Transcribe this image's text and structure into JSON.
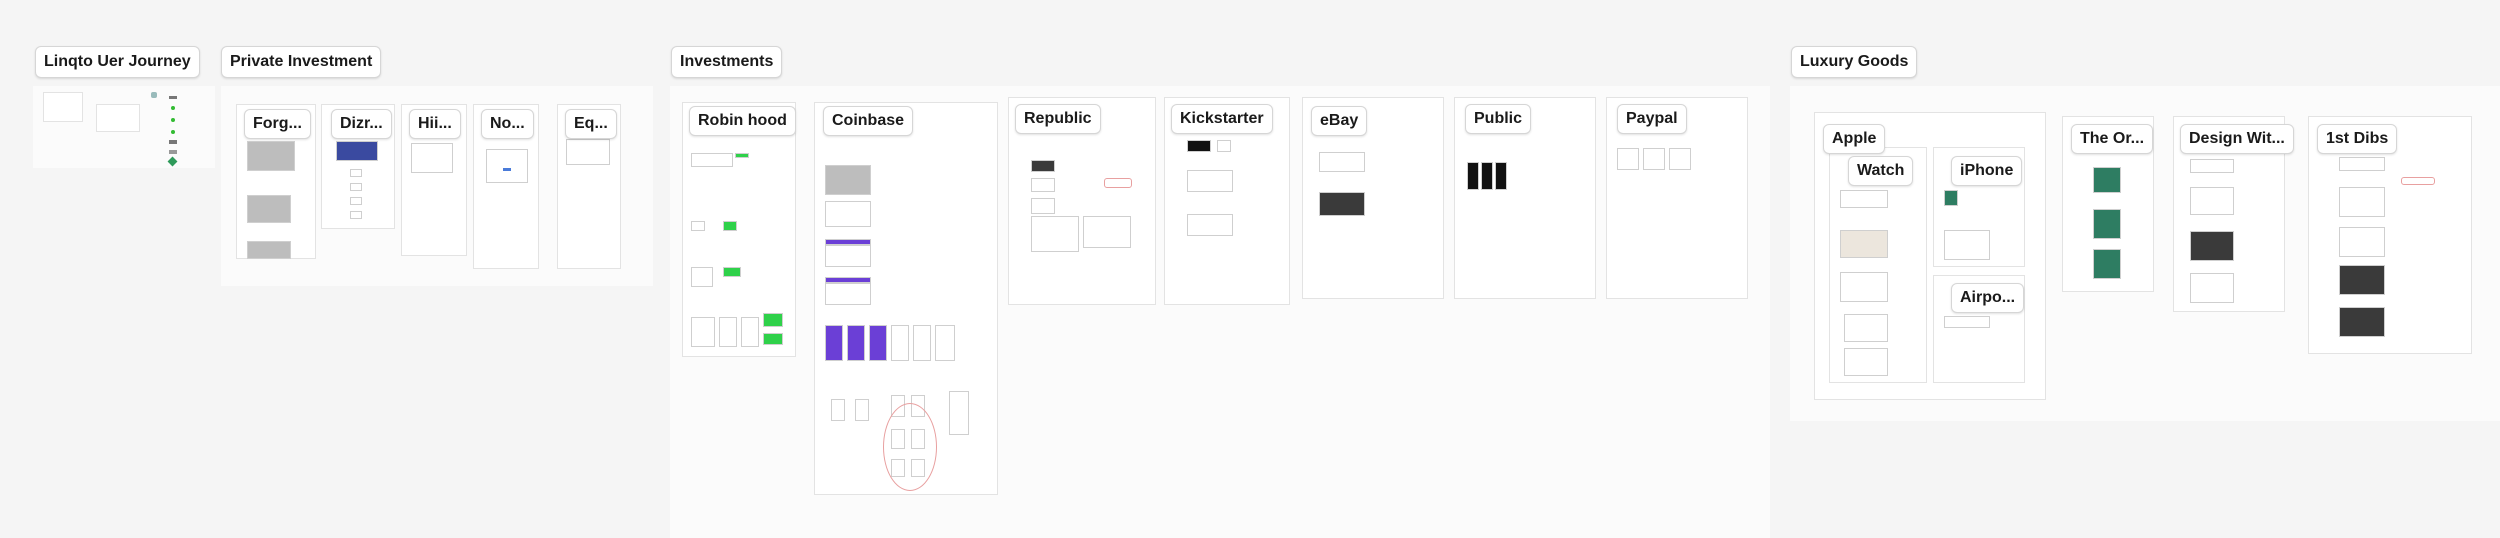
{
  "canvas": {
    "background": "#f5f5f5",
    "section_bg": "#fbfbfb"
  },
  "sections": {
    "linqto": {
      "title": "Linqto Uer Journey"
    },
    "private_investment": {
      "title": "Private Investment",
      "frames": [
        "Forg...",
        "Dizr...",
        "Hii...",
        "No...",
        "Eq..."
      ]
    },
    "investments": {
      "title": "Investments",
      "frames": [
        "Robin hood",
        "Coinbase",
        "Republic",
        "Kickstarter",
        "eBay",
        "Public",
        "Paypal"
      ]
    },
    "luxury_goods": {
      "title": "Luxury Goods",
      "apple": {
        "title": "Apple",
        "sub": [
          "Watch",
          "iPhone",
          "Airpo..."
        ]
      },
      "frames": [
        "The Or...",
        "Design Wit...",
        "1st Dibs"
      ]
    }
  },
  "colors": {
    "purple": "#6b3fd6",
    "green": "#2fd14a",
    "annotation_red": "#e8a0a0",
    "link_blue": "#4a7bd9"
  }
}
